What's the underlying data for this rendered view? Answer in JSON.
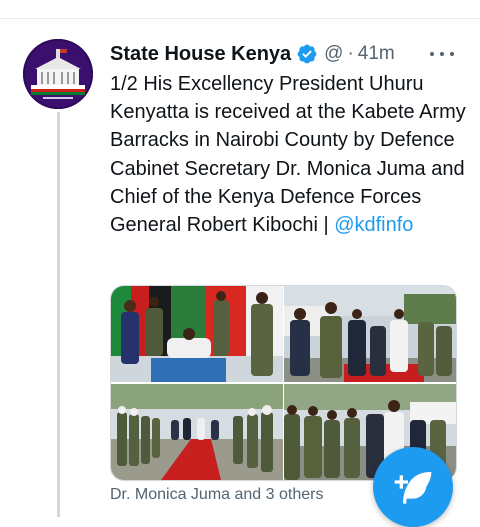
{
  "tweet": {
    "author_name": "State House Kenya",
    "handle": "@",
    "separator": "·",
    "timestamp": "41m",
    "text_main": "1/2 His Excellency President Uhuru Kenyatta is received at the Kabete Army Barracks in Nairobi County by Defence Cabinet Secretary Dr. Monica Juma and Chief of the Kenya Defence Forces General Robert Kibochi | ",
    "mention": "@kdfinfo",
    "tagged_people": "Dr. Monica Juma and 3 others",
    "verified": true,
    "photo_count": 4
  },
  "icons": {
    "verified": "verified-badge-icon",
    "more": "more-options-icon",
    "compose": "compose-tweet-icon"
  },
  "colors": {
    "accent": "#1d9bf0",
    "text_primary": "#0f1419",
    "text_secondary": "#536471",
    "border": "#cfd9de"
  }
}
